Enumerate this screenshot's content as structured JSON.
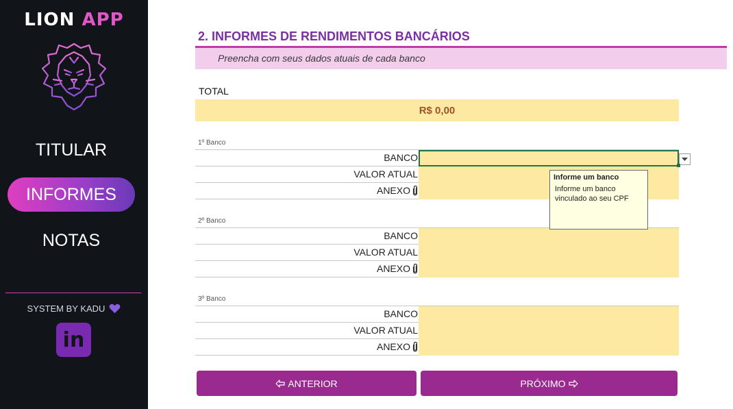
{
  "sidebar": {
    "app_title_part1": "LION",
    "app_title_part2": "APP",
    "logo_icon": "lion-head-icon",
    "nav": [
      {
        "label": "TITULAR",
        "active": false
      },
      {
        "label": "INFORMES",
        "active": true
      },
      {
        "label": "NOTAS",
        "active": false
      }
    ],
    "system_by": "SYSTEM BY KADU",
    "heart_icon": "heart-icon",
    "linkedin_label": "in",
    "accent_color": "#e057c8"
  },
  "main": {
    "section_title": "2. INFORMES DE RENDIMENTOS BANCÁRIOS",
    "subtitle": "Preencha com seus dados atuais de cada banco",
    "total_label": "TOTAL",
    "total_value": "R$ 0,00",
    "banks": [
      {
        "title": "1º Banco",
        "rows": [
          "BANCO",
          "VALOR ATUAL",
          "ANEXO"
        ]
      },
      {
        "title": "2º Banco",
        "rows": [
          "BANCO",
          "VALOR ATUAL",
          "ANEXO"
        ]
      },
      {
        "title": "3º Banco",
        "rows": [
          "BANCO",
          "VALOR ATUAL",
          "ANEXO"
        ]
      }
    ],
    "tooltip": {
      "title": "Informe um banco",
      "body": "Informe um banco vinculado ao seu CPF"
    },
    "buttons": {
      "prev_label": "ANTERIOR",
      "next_label": "PRÓXIMO"
    }
  }
}
